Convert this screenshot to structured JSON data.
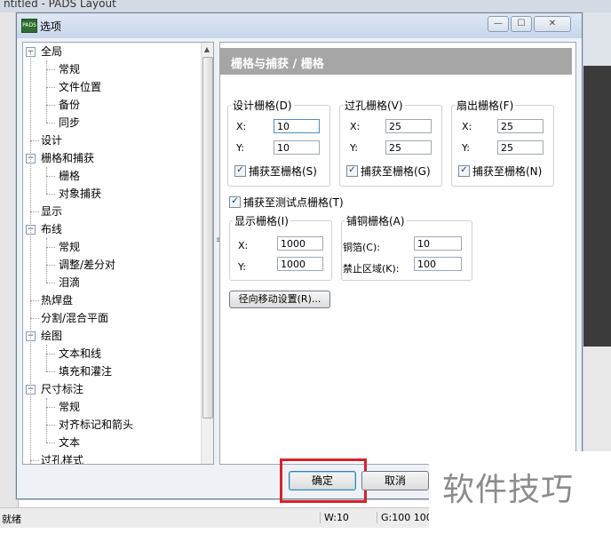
{
  "app": {
    "title": "ntitled - PADS Layout",
    "status": {
      "ready": "就绪",
      "width": "W:10",
      "grid": "G:100 100"
    }
  },
  "dialog": {
    "title": "选项",
    "tree": {
      "nodes": [
        {
          "label": "全局",
          "level": 0,
          "toggle": "−"
        },
        {
          "label": "常规",
          "level": 1
        },
        {
          "label": "文件位置",
          "level": 1
        },
        {
          "label": "备份",
          "level": 1
        },
        {
          "label": "同步",
          "level": 1
        },
        {
          "label": "设计",
          "level": 0
        },
        {
          "label": "栅格和捕获",
          "level": 0,
          "toggle": "−"
        },
        {
          "label": "栅格",
          "level": 1
        },
        {
          "label": "对象捕获",
          "level": 1
        },
        {
          "label": "显示",
          "level": 0
        },
        {
          "label": "布线",
          "level": 0,
          "toggle": "−"
        },
        {
          "label": "常规",
          "level": 1
        },
        {
          "label": "调整/差分对",
          "level": 1
        },
        {
          "label": "泪滴",
          "level": 1
        },
        {
          "label": "热焊盘",
          "level": 0
        },
        {
          "label": "分割/混合平面",
          "level": 0
        },
        {
          "label": "绘图",
          "level": 0,
          "toggle": "−"
        },
        {
          "label": "文本和线",
          "level": 1
        },
        {
          "label": "填充和灌注",
          "level": 1
        },
        {
          "label": "尺寸标注",
          "level": 0,
          "toggle": "−"
        },
        {
          "label": "常规",
          "level": 1
        },
        {
          "label": "对齐标记和箭头",
          "level": 1
        },
        {
          "label": "文本",
          "level": 1
        },
        {
          "label": "过孔样式",
          "level": 0
        }
      ]
    },
    "panel": {
      "header": "栅格与捕获 / 栅格",
      "design_grid": {
        "legend": "设计栅格(D)",
        "x_label": "X:",
        "x": "10",
        "y_label": "Y:",
        "y": "10",
        "snap": "捕获至栅格(S)"
      },
      "via_grid": {
        "legend": "过孔栅格(V)",
        "x_label": "X:",
        "x": "25",
        "y_label": "Y:",
        "y": "25",
        "snap": "捕获至栅格(G)"
      },
      "fanout_grid": {
        "legend": "扇出栅格(F)",
        "x_label": "X:",
        "x": "25",
        "y_label": "Y:",
        "y": "25",
        "snap": "捕获至栅格(N)"
      },
      "test_point_snap": "捕获至测试点栅格(T)",
      "display_grid": {
        "legend": "显示栅格(I)",
        "x_label": "X:",
        "x": "1000",
        "y_label": "Y:",
        "y": "1000"
      },
      "copper_grid": {
        "legend": "铺铜栅格(A)",
        "foil_label": "铜箔(C):",
        "foil": "10",
        "keepout_label": "禁止区域(K):",
        "keepout": "100"
      },
      "radial_button": "径向移动设置(R)..."
    },
    "buttons": {
      "ok": "确定",
      "cancel": "取消"
    },
    "window_buttons": {
      "min": "—",
      "max": "☐",
      "close": "✕"
    }
  },
  "watermark": "软件技巧"
}
